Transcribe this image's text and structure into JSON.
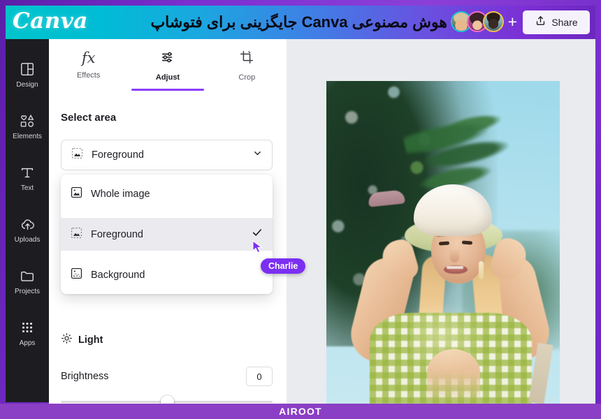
{
  "banner": {
    "logo": "Canva",
    "title": "هوش مصنوعی Canva جایگزینی برای فتوشاپ",
    "share_label": "Share",
    "share_icon": "upload-icon",
    "add_collaborator": "+",
    "avatars": [
      {
        "name": "collaborator-1",
        "ring": "#19c6d6"
      },
      {
        "name": "collaborator-2",
        "ring": "#f06ec8"
      },
      {
        "name": "collaborator-3",
        "ring": "#f5c542"
      }
    ]
  },
  "rail": {
    "items": [
      {
        "label": "Design",
        "icon": "layout-icon"
      },
      {
        "label": "Elements",
        "icon": "shapes-icon"
      },
      {
        "label": "Text",
        "icon": "text-icon"
      },
      {
        "label": "Uploads",
        "icon": "cloud-upload-icon"
      },
      {
        "label": "Projects",
        "icon": "folder-icon"
      },
      {
        "label": "Apps",
        "icon": "grid-dots-icon"
      }
    ]
  },
  "panel": {
    "tabs": [
      {
        "label": "Effects",
        "icon": "fx-icon",
        "active": false
      },
      {
        "label": "Adjust",
        "icon": "sliders-icon",
        "active": true
      },
      {
        "label": "Crop",
        "icon": "crop-icon",
        "active": false
      }
    ],
    "select_area": {
      "label": "Select area",
      "value": "Foreground",
      "icon": "image-foreground-icon",
      "chevron": "chevron-down-icon",
      "options": [
        {
          "label": "Whole image",
          "icon": "image-whole-icon",
          "selected": false
        },
        {
          "label": "Foreground",
          "icon": "image-foreground-icon",
          "selected": true
        },
        {
          "label": "Background",
          "icon": "image-background-icon",
          "selected": false
        }
      ]
    },
    "light": {
      "section_label": "Light",
      "section_icon": "sun-icon",
      "brightness_label": "Brightness",
      "brightness_value": "0",
      "brightness_percent": 50
    }
  },
  "canvas": {
    "cursor_name": "Charlie",
    "cursor_color": "#7b2ff2",
    "photo_alt": "woman in white bucket hat and green gingham top"
  },
  "watermark": {
    "text": "AIROOT"
  },
  "colors": {
    "accent_purple": "#8b3dff",
    "cursor_purple": "#7b2ff2",
    "frame_purple": "#7c2fd0",
    "banner_teal": "#00c4cc",
    "rail_dark": "#1d1d21",
    "canvas_gray": "#e9ebee"
  }
}
